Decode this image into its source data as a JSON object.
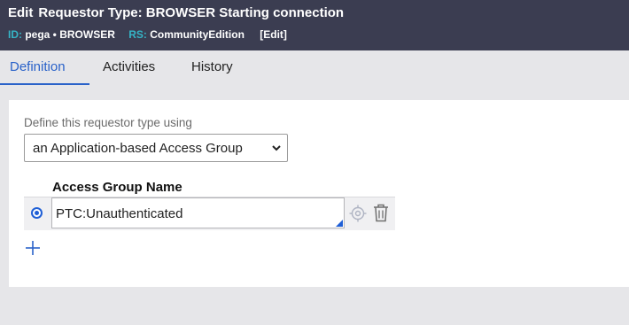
{
  "header": {
    "edit_word": "Edit",
    "title": "Requestor Type: BROWSER Starting connection",
    "id_label": "ID:",
    "id_value": "pega • BROWSER",
    "rs_label": "RS:",
    "rs_value": "CommunityEdition",
    "edit_link": "[Edit]"
  },
  "tabs": [
    {
      "label": "Definition",
      "active": true
    },
    {
      "label": "Activities",
      "active": false
    },
    {
      "label": "History",
      "active": false
    }
  ],
  "form": {
    "define_label": "Define this requestor type using",
    "define_select_value": "an Application-based Access Group",
    "access_group_header": "Access Group Name",
    "rows": [
      {
        "value": "PTC:Unauthenticated",
        "selected": true
      }
    ]
  },
  "icons": {
    "chevron": "chevron-down-icon",
    "target": "crosshair-icon",
    "delete": "trash-icon",
    "add": "plus-icon"
  },
  "colors": {
    "header_bg": "#3b3d51",
    "meta_key": "#35b4c6",
    "accent": "#2a62c9",
    "page_bg": "#e6e6e9"
  }
}
